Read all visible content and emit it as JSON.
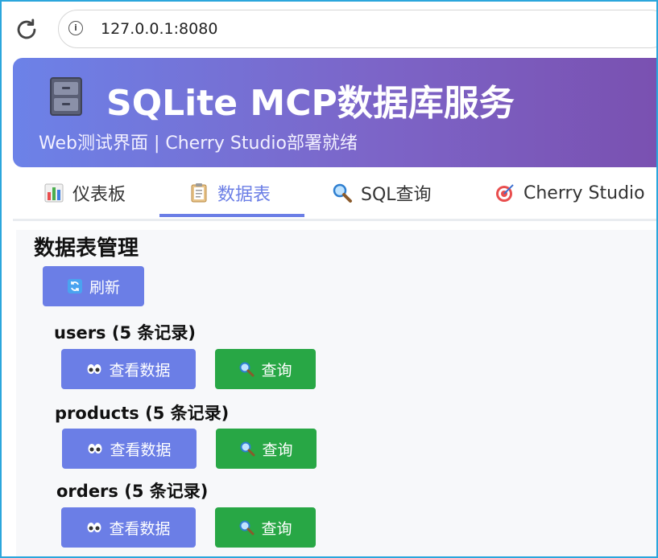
{
  "browser": {
    "url": "127.0.0.1:8080"
  },
  "header": {
    "title": "SQLite MCP数据库服务",
    "subtitle": "Web测试界面 | Cherry Studio部署就绪"
  },
  "tabs": [
    {
      "label": "仪表板",
      "icon": "bar-chart-icon"
    },
    {
      "label": "数据表",
      "icon": "clipboard-icon",
      "active": true
    },
    {
      "label": "SQL查询",
      "icon": "magnifier-icon"
    },
    {
      "label": "Cherry Studio",
      "icon": "target-icon"
    }
  ],
  "main": {
    "title": "数据表管理",
    "refresh_label": "刷新",
    "tables": [
      {
        "name": "users (5 条记录)",
        "view_label": "查看数据",
        "query_label": "查询"
      },
      {
        "name": "products (5 条记录)",
        "view_label": "查看数据",
        "query_label": "查询"
      },
      {
        "name": "orders (5 条记录)",
        "view_label": "查看数据",
        "query_label": "查询"
      }
    ]
  },
  "colors": {
    "accent": "#6b7ee6",
    "success": "#28a745",
    "frame": "#2ba6dc"
  }
}
